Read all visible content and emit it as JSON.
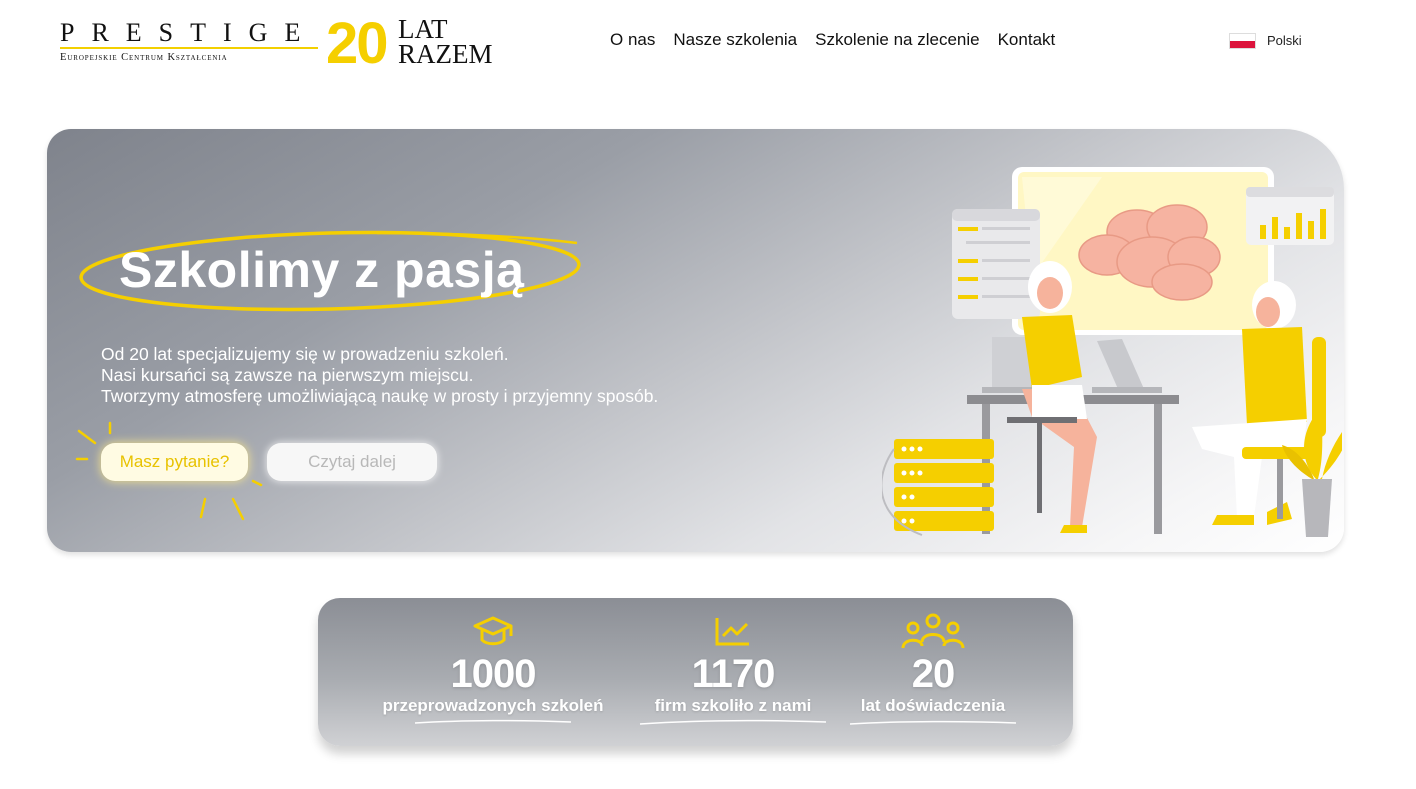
{
  "header": {
    "logo": {
      "brand": "PRESTIGE",
      "subtitle": "Europejskie Centrum Kształcenia",
      "anniversary_number": "20",
      "anniversary_line1": "LAT",
      "anniversary_line2": "RAZEM"
    },
    "nav": [
      "O nas",
      "Nasze szkolenia",
      "Szkolenie na zlecenie",
      "Kontakt"
    ],
    "language": {
      "label": "Polski",
      "flag": "poland-flag-icon"
    }
  },
  "hero": {
    "title": "Szkolimy z pasją",
    "description": [
      "Od 20 lat specjalizujemy się w prowadzeniu szkoleń.",
      "Nasi kursańci są zawsze na pierwszym miejscu.",
      "Tworzymy atmosferę umożliwiającą naukę w prosty i przyjemny sposób."
    ],
    "buttons": {
      "primary": "Masz pytanie?",
      "secondary": "Czytaj dalej"
    },
    "illustration": "office-training-illustration"
  },
  "stats": [
    {
      "icon": "graduation-cap-icon",
      "value": "1000",
      "label": "przeprowadzonych szkoleń"
    },
    {
      "icon": "chart-line-icon",
      "value": "1170",
      "label": "firm szkoliło z nami"
    },
    {
      "icon": "group-icon",
      "value": "20",
      "label": "lat doświadczenia"
    }
  ],
  "colors": {
    "accent": "#f5cf00",
    "hero_gradient_dark": "#7f838c",
    "text_dark": "#111111",
    "white": "#ffffff"
  }
}
